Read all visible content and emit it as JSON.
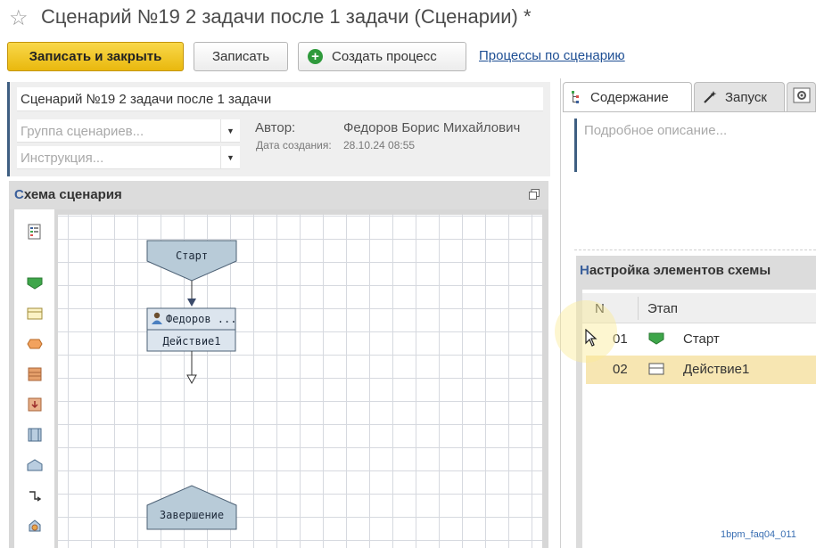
{
  "window": {
    "title": "Сценарий №19 2 задачи после 1 задачи (Сценарии) *"
  },
  "toolbar": {
    "save_close": "Записать и закрыть",
    "save": "Записать",
    "create_process": "Создать процесс",
    "processes_link": "Процессы по сценарию"
  },
  "form": {
    "name": "Сценарий №19 2 задачи после 1 задачи",
    "group_placeholder": "Группа сценариев...",
    "instruction_placeholder": "Инструкция...",
    "author_label": "Автор:",
    "author_value": "Федоров Борис Михайлович",
    "date_label": "Дата создания:",
    "date_value": "28.10.24 08:55"
  },
  "schema": {
    "title_first": "С",
    "title_rest": "хема сценария",
    "palette": [
      "schema-settings-icon",
      "start-shape-icon",
      "action-shape-icon",
      "condition-shape-icon",
      "subprocess-shape-icon",
      "handler-shape-icon",
      "parallel-shape-icon",
      "end-shape-icon",
      "connector-icon",
      "misc-shape-icon"
    ],
    "nodes": {
      "start": "Старт",
      "action_performer": "Федоров ...",
      "action_name": "Действие1",
      "end": "Завершение"
    }
  },
  "tabs": {
    "content": "Содержание",
    "run": "Запуск"
  },
  "description_placeholder": "Подробное описание...",
  "elements": {
    "title_first": "Н",
    "title_rest": "астройка элементов схемы",
    "columns": {
      "n": "N",
      "stage": "Этап"
    },
    "rows": [
      {
        "n": "01",
        "name": "Старт",
        "icon": "start-shape-icon"
      },
      {
        "n": "02",
        "name": "Действие1",
        "icon": "action-shape-icon"
      }
    ]
  },
  "footer_id": "1bpm_faq04_011",
  "colors": {
    "primary_button": "#f0c52a",
    "accent_blue": "#3a5f9b",
    "selected_row": "#f7e6b2",
    "start_green": "#3ea64a"
  }
}
